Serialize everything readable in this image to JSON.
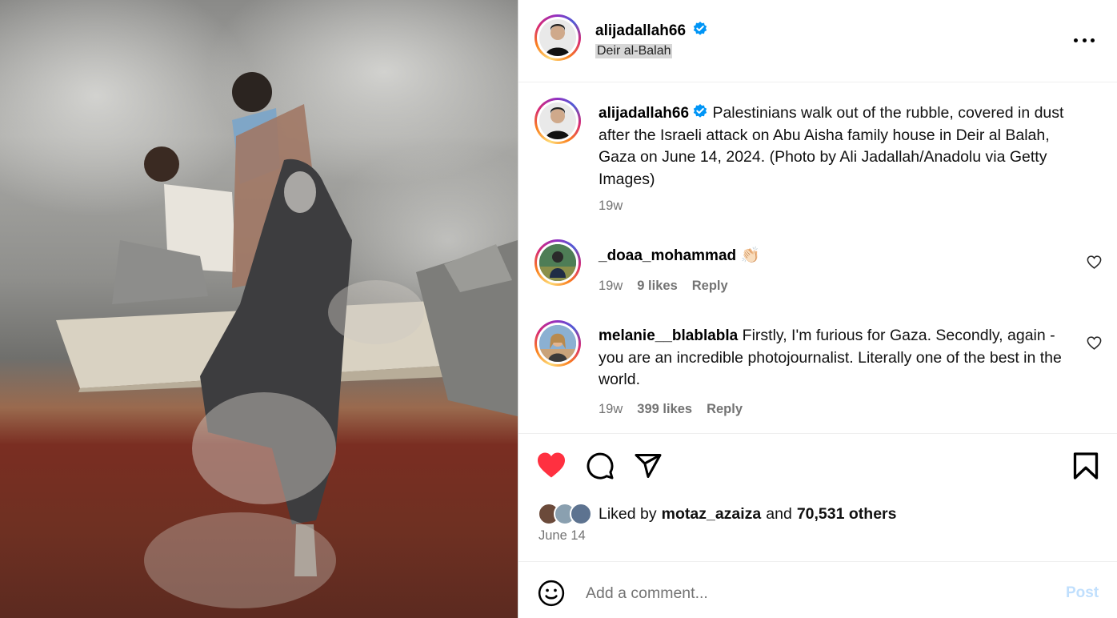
{
  "post": {
    "photo_alt": "Palestinians walk out of the rubble covered in dust",
    "author": {
      "username": "alijadallah66",
      "verified_icon": "verified-badge-icon",
      "location": "Deir al-Balah"
    },
    "caption": {
      "username": "alijadallah66",
      "text": "Palestinians walk out of the rubble, covered in dust after the Israeli attack on Abu Aisha family house in Deir al Balah, Gaza on June 14, 2024. (Photo by Ali Jadallah/Anadolu via Getty Images)",
      "age": "19w"
    },
    "comments": [
      {
        "username": "_doaa_mohammad",
        "text": "👏🏻",
        "age": "19w",
        "likes": "9 likes",
        "reply": "Reply"
      },
      {
        "username": "melanie__blablabla",
        "text": "Firstly, I'm furious for Gaza. Secondly, again - you are an incredible photojournalist. Literally one of the best in the world.",
        "age": "19w",
        "likes": "399 likes",
        "reply": "Reply"
      }
    ],
    "likes": {
      "prefix": "Liked by",
      "user": "motaz_azaiza",
      "middle": "and",
      "others": "70,531 others"
    },
    "date": "June 14",
    "comment_box": {
      "placeholder": "Add a comment...",
      "post_label": "Post"
    },
    "colors": {
      "heart_liked": "#ff3040",
      "post_disabled": "#c0dffd",
      "verified": "#0095f6"
    }
  }
}
